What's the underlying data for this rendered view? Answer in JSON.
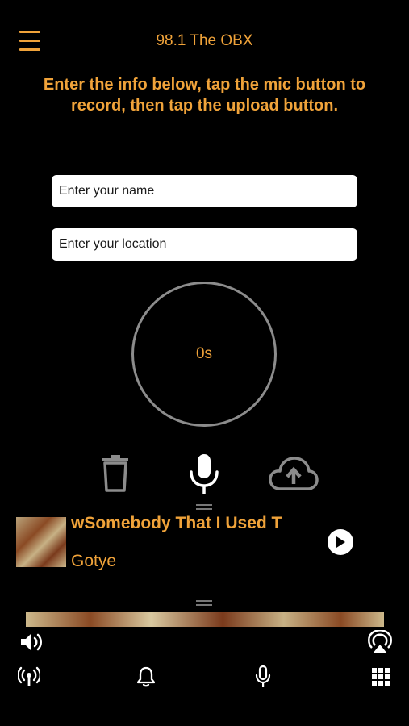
{
  "header": {
    "title": "98.1 The OBX",
    "menu_icon": "menu-icon"
  },
  "instructions": "Enter the info below, tap the mic button to record, then tap the upload button.",
  "form": {
    "name_placeholder": "Enter your name",
    "location_placeholder": "Enter your location"
  },
  "recorder": {
    "timer": "0s",
    "delete_icon": "trash-icon",
    "record_icon": "microphone-icon",
    "upload_icon": "cloud-upload-icon"
  },
  "now_playing": {
    "song": "wSomebody That I Used T",
    "artist": "Gotye",
    "play_icon": "play-icon"
  },
  "bottom_bar": {
    "volume_icon": "volume-icon",
    "airplay_icon": "airplay-icon",
    "tabs": [
      "radio-icon",
      "bell-icon",
      "microphone-icon",
      "grid-icon"
    ]
  },
  "colors": {
    "accent": "#f0a33a",
    "background": "#000000"
  }
}
